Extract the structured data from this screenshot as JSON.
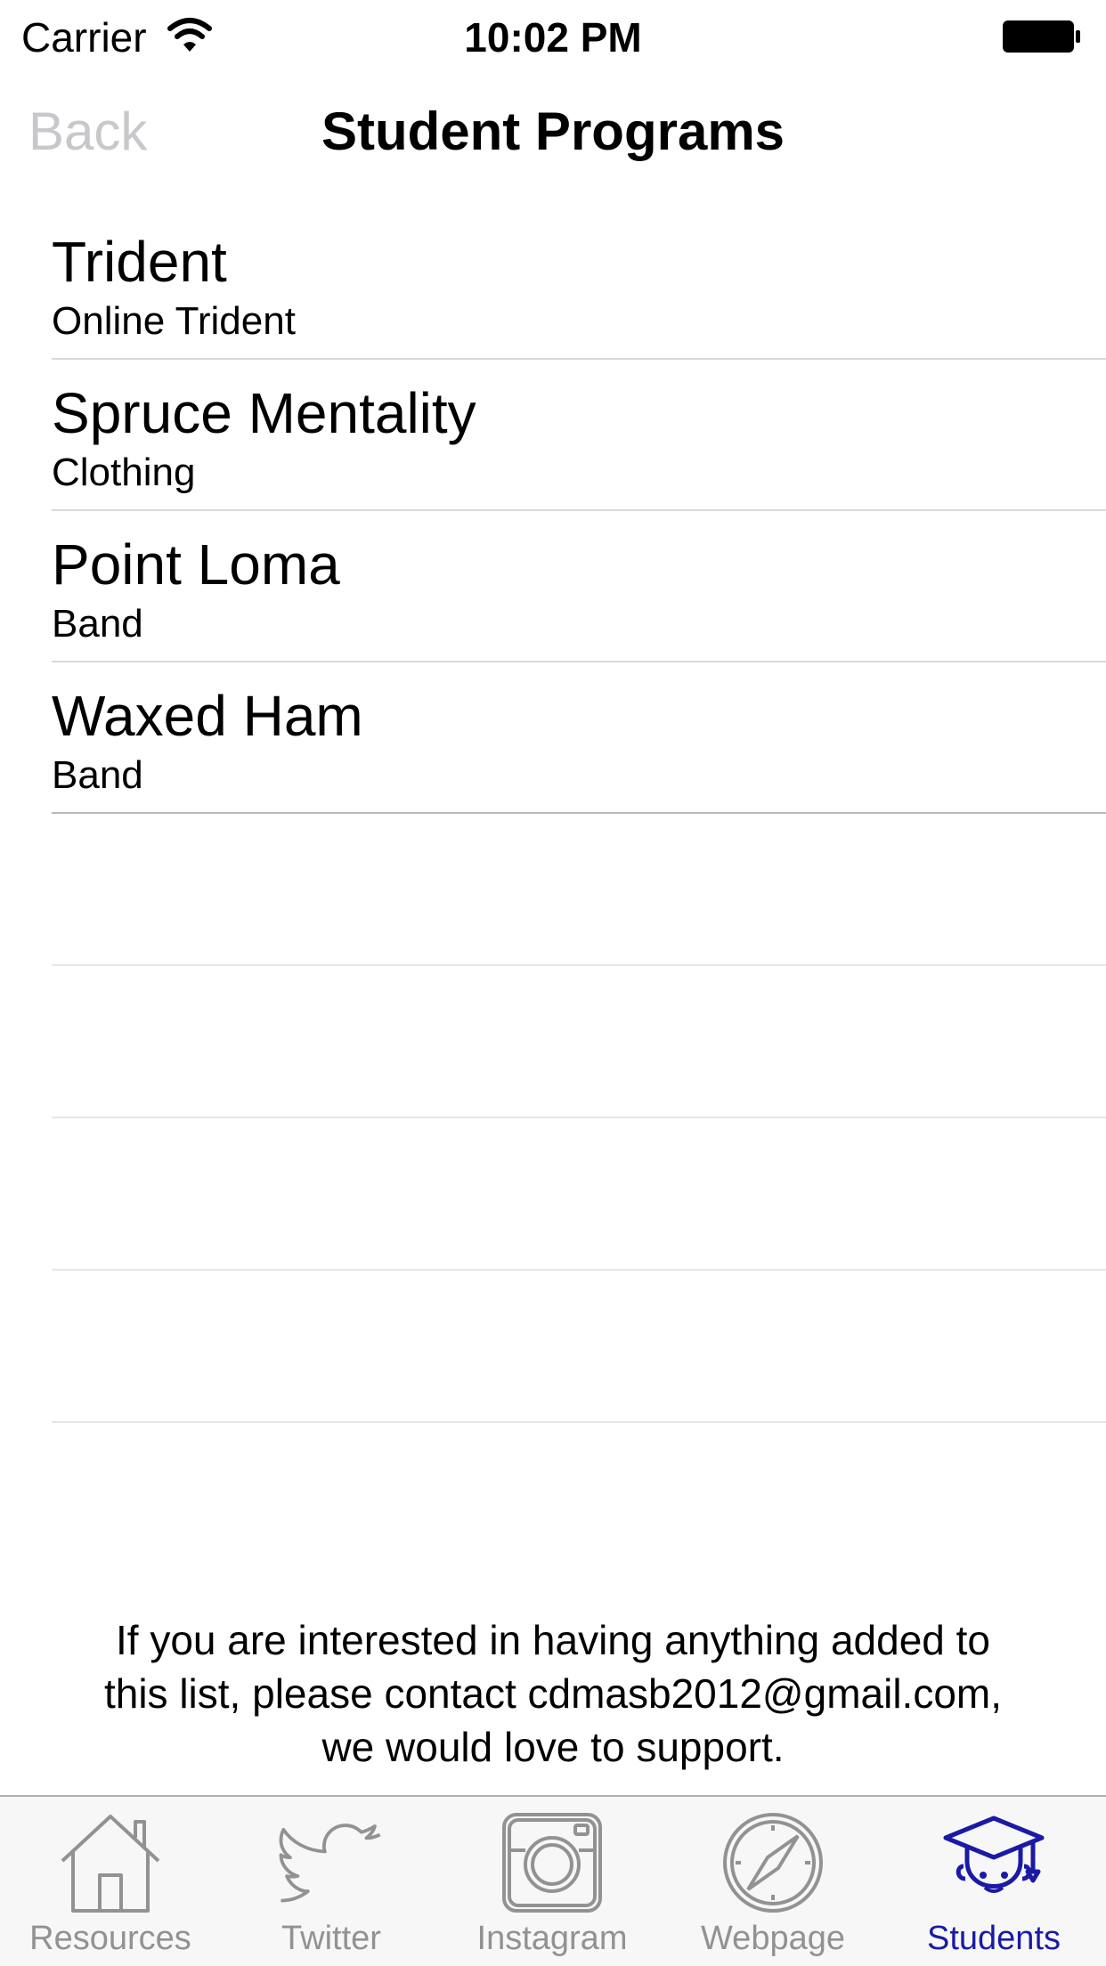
{
  "status_bar": {
    "carrier": "Carrier",
    "time": "10:02 PM"
  },
  "nav": {
    "back_label": "Back",
    "title": "Student Programs"
  },
  "programs": [
    {
      "title": "Trident",
      "subtitle": "Online Trident"
    },
    {
      "title": "Spruce Mentality",
      "subtitle": "Clothing"
    },
    {
      "title": "Point Loma",
      "subtitle": "Band"
    },
    {
      "title": "Waxed Ham",
      "subtitle": "Band"
    }
  ],
  "footer": {
    "line1": "If you are interested in having anything added to",
    "line2": "this list, please contact cdmasb2012@gmail.com,",
    "line3": "we would love to support."
  },
  "tabs": [
    {
      "label": "Resources",
      "icon": "house-icon",
      "active": false
    },
    {
      "label": "Twitter",
      "icon": "twitter-bird-icon",
      "active": false
    },
    {
      "label": "Instagram",
      "icon": "camera-icon",
      "active": false
    },
    {
      "label": "Webpage",
      "icon": "compass-icon",
      "active": false
    },
    {
      "label": "Students",
      "icon": "graduate-icon",
      "active": true
    }
  ],
  "colors": {
    "active_tab": "#1a1aa6",
    "inactive_tab": "#929292",
    "back_disabled": "#c8c8cc"
  }
}
